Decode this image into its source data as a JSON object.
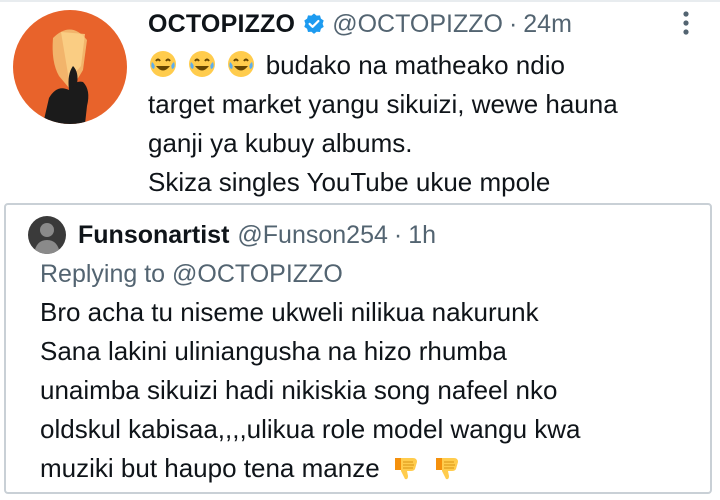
{
  "tweet": {
    "display_name": "OCTOPIZZO",
    "handle": "@OCTOPIZZO",
    "separator": "·",
    "time": "24m",
    "avatar_icon": "avatar-silhouette",
    "verified_icon": "verified-badge-icon",
    "more_icon": "more-vertical-icon",
    "emoji_prefix_icon": "laughing-crying-emoji",
    "text_lines": [
      "budako na matheako ndio",
      "target market yangu sikuizi, wewe hauna",
      "ganji ya kubuy albums.",
      "Skiza singles YouTube ukue mpole"
    ]
  },
  "quote": {
    "display_name": "Funsonartist",
    "handle": "@Funson254",
    "separator": "·",
    "time": "1h",
    "replying_prefix": "Replying to",
    "replying_to": "@OCTOPIZZO",
    "text_lines": [
      "Bro acha tu niseme ukweli nilikua nakurunk",
      "Sana lakini uliniangusha na hizo rhumba",
      "unaimba sikuizi hadi nikiskia song nafeel nko",
      "oldskul kabisaa,,,,ulikua role model wangu kwa",
      "muziki but haupo tena manze"
    ],
    "emoji_suffix_icon": "thumbs-down-emoji"
  },
  "colors": {
    "text": "#0f1419",
    "muted": "#536471",
    "verified": "#1d9bf0",
    "avatar_orange": "#e8632b",
    "border": "#c9d0d6"
  }
}
